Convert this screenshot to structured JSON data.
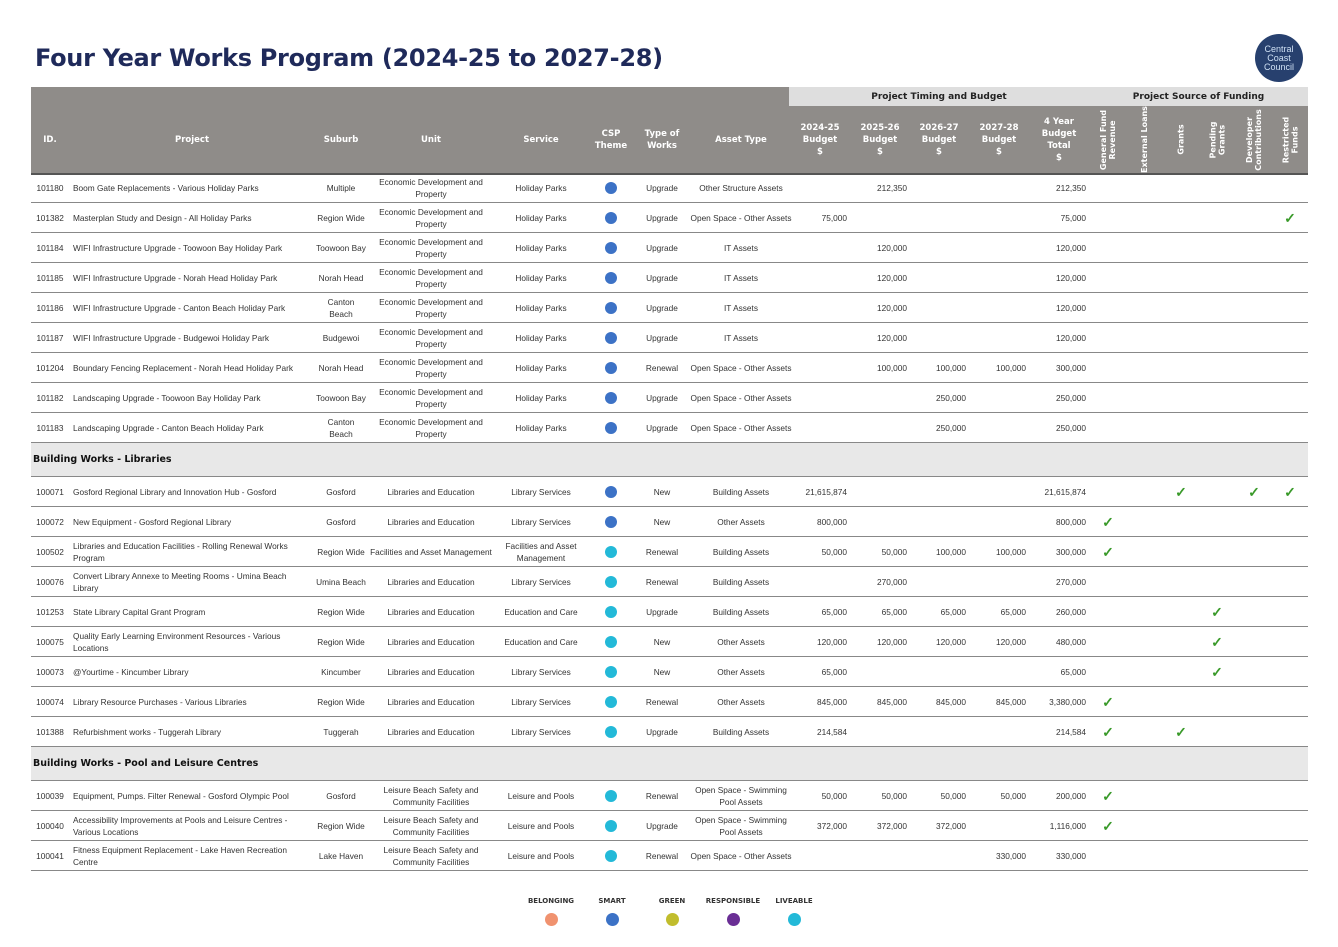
{
  "page": {
    "title": "Four Year Works Program (2024-25 to 2027-28)",
    "logo_lines": [
      "Central",
      "Coast",
      "Council"
    ]
  },
  "bands": {
    "timing": "Project Timing and Budget",
    "funding": "Project Source of Funding"
  },
  "columns": {
    "id": "ID.",
    "project": "Project",
    "suburb": "Suburb",
    "unit": "Unit",
    "service": "Service",
    "csp_theme": "CSP\nTheme",
    "type_of_works": "Type of\nWorks",
    "asset_type": "Asset Type",
    "y2024": "2024-25\nBudget\n$",
    "y2025": "2025-26\nBudget\n$",
    "y2026": "2026-27\nBudget\n$",
    "y2027": "2027-28\nBudget\n$",
    "total": "4 Year\nBudget\nTotal\n$",
    "funding": [
      "General Fund\nRevenue",
      "External Loans",
      "Grants",
      "Pending\nGrants",
      "Developer\nContributions",
      "Restricted\nFunds"
    ]
  },
  "theme_colors": {
    "belonging": "#f0926f",
    "smart": "#3c72c6",
    "green": "#c1bd2d",
    "responsible": "#6a2e95",
    "liveable": "#23b9d8"
  },
  "sections": [
    {
      "heading": "",
      "rows": [
        {
          "id": "101180",
          "project": "Boom Gate Replacements - Various Holiday Parks",
          "suburb": "Multiple",
          "unit": "Economic Development and Property",
          "service": "Holiday Parks",
          "theme": "smart",
          "works": "Upgrade",
          "asset": "Other Structure Assets",
          "b1": "",
          "b2": "212,350",
          "b3": "",
          "b4": "",
          "total": "212,350",
          "f": [
            false,
            false,
            false,
            false,
            false,
            false
          ]
        },
        {
          "id": "101382",
          "project": "Masterplan Study and Design - All Holiday Parks",
          "suburb": "Region Wide",
          "unit": "Economic Development and Property",
          "service": "Holiday Parks",
          "theme": "smart",
          "works": "Upgrade",
          "asset": "Open Space - Other Assets",
          "b1": "75,000",
          "b2": "",
          "b3": "",
          "b4": "",
          "total": "75,000",
          "f": [
            false,
            false,
            false,
            false,
            false,
            true
          ]
        },
        {
          "id": "101184",
          "project": "WIFI Infrastructure Upgrade - Toowoon Bay Holiday Park",
          "suburb": "Toowoon Bay",
          "unit": "Economic Development and Property",
          "service": "Holiday Parks",
          "theme": "smart",
          "works": "Upgrade",
          "asset": "IT Assets",
          "b1": "",
          "b2": "120,000",
          "b3": "",
          "b4": "",
          "total": "120,000",
          "f": [
            false,
            false,
            false,
            false,
            false,
            false
          ]
        },
        {
          "id": "101185",
          "project": "WIFI Infrastructure Upgrade - Norah Head Holiday Park",
          "suburb": "Norah Head",
          "unit": "Economic Development and Property",
          "service": "Holiday Parks",
          "theme": "smart",
          "works": "Upgrade",
          "asset": "IT Assets",
          "b1": "",
          "b2": "120,000",
          "b3": "",
          "b4": "",
          "total": "120,000",
          "f": [
            false,
            false,
            false,
            false,
            false,
            false
          ]
        },
        {
          "id": "101186",
          "project": "WIFI Infrastructure Upgrade - Canton Beach Holiday Park",
          "suburb": "Canton Beach",
          "unit": "Economic Development and Property",
          "service": "Holiday Parks",
          "theme": "smart",
          "works": "Upgrade",
          "asset": "IT Assets",
          "b1": "",
          "b2": "120,000",
          "b3": "",
          "b4": "",
          "total": "120,000",
          "f": [
            false,
            false,
            false,
            false,
            false,
            false
          ]
        },
        {
          "id": "101187",
          "project": "WIFI Infrastructure Upgrade - Budgewoi Holiday Park",
          "suburb": "Budgewoi",
          "unit": "Economic Development and Property",
          "service": "Holiday Parks",
          "theme": "smart",
          "works": "Upgrade",
          "asset": "IT Assets",
          "b1": "",
          "b2": "120,000",
          "b3": "",
          "b4": "",
          "total": "120,000",
          "f": [
            false,
            false,
            false,
            false,
            false,
            false
          ]
        },
        {
          "id": "101204",
          "project": "Boundary Fencing Replacement - Norah Head Holiday Park",
          "suburb": "Norah Head",
          "unit": "Economic Development and Property",
          "service": "Holiday Parks",
          "theme": "smart",
          "works": "Renewal",
          "asset": "Open Space - Other Assets",
          "b1": "",
          "b2": "100,000",
          "b3": "100,000",
          "b4": "100,000",
          "total": "300,000",
          "f": [
            false,
            false,
            false,
            false,
            false,
            false
          ]
        },
        {
          "id": "101182",
          "project": "Landscaping Upgrade - Toowoon Bay Holiday Park",
          "suburb": "Toowoon Bay",
          "unit": "Economic Development and Property",
          "service": "Holiday Parks",
          "theme": "smart",
          "works": "Upgrade",
          "asset": "Open Space - Other Assets",
          "b1": "",
          "b2": "",
          "b3": "250,000",
          "b4": "",
          "total": "250,000",
          "f": [
            false,
            false,
            false,
            false,
            false,
            false
          ]
        },
        {
          "id": "101183",
          "project": "Landscaping Upgrade - Canton Beach Holiday Park",
          "suburb": "Canton Beach",
          "unit": "Economic Development and Property",
          "service": "Holiday Parks",
          "theme": "smart",
          "works": "Upgrade",
          "asset": "Open Space - Other Assets",
          "b1": "",
          "b2": "",
          "b3": "250,000",
          "b4": "",
          "total": "250,000",
          "f": [
            false,
            false,
            false,
            false,
            false,
            false
          ]
        }
      ]
    },
    {
      "heading": "Building Works - Libraries",
      "rows": [
        {
          "id": "100071",
          "project": "Gosford Regional Library and Innovation Hub - Gosford",
          "suburb": "Gosford",
          "unit": "Libraries and Education",
          "service": "Library Services",
          "theme": "smart",
          "works": "New",
          "asset": "Building Assets",
          "b1": "21,615,874",
          "b2": "",
          "b3": "",
          "b4": "",
          "total": "21,615,874",
          "f": [
            false,
            false,
            true,
            false,
            true,
            true
          ]
        },
        {
          "id": "100072",
          "project": "New Equipment - Gosford Regional Library",
          "suburb": "Gosford",
          "unit": "Libraries and Education",
          "service": "Library Services",
          "theme": "smart",
          "works": "New",
          "asset": "Other Assets",
          "b1": "800,000",
          "b2": "",
          "b3": "",
          "b4": "",
          "total": "800,000",
          "f": [
            true,
            false,
            false,
            false,
            false,
            false
          ]
        },
        {
          "id": "100502",
          "project": "Libraries and Education Facilities - Rolling Renewal Works Program",
          "suburb": "Region Wide",
          "unit": "Facilities and Asset Management",
          "service": "Facilities and Asset Management",
          "theme": "liveable",
          "works": "Renewal",
          "asset": "Building Assets",
          "b1": "50,000",
          "b2": "50,000",
          "b3": "100,000",
          "b4": "100,000",
          "total": "300,000",
          "f": [
            true,
            false,
            false,
            false,
            false,
            false
          ]
        },
        {
          "id": "100076",
          "project": "Convert Library Annexe to Meeting Rooms - Umina Beach Library",
          "suburb": "Umina Beach",
          "unit": "Libraries and Education",
          "service": "Library Services",
          "theme": "liveable",
          "works": "Renewal",
          "asset": "Building Assets",
          "b1": "",
          "b2": "270,000",
          "b3": "",
          "b4": "",
          "total": "270,000",
          "f": [
            false,
            false,
            false,
            false,
            false,
            false
          ]
        },
        {
          "id": "101253",
          "project": "State Library Capital Grant Program",
          "suburb": "Region Wide",
          "unit": "Libraries and Education",
          "service": "Education and Care",
          "theme": "liveable",
          "works": "Upgrade",
          "asset": "Building Assets",
          "b1": "65,000",
          "b2": "65,000",
          "b3": "65,000",
          "b4": "65,000",
          "total": "260,000",
          "f": [
            false,
            false,
            false,
            true,
            false,
            false
          ]
        },
        {
          "id": "100075",
          "project": "Quality Early Learning Environment Resources - Various Locations",
          "suburb": "Region Wide",
          "unit": "Libraries and Education",
          "service": "Education and Care",
          "theme": "liveable",
          "works": "New",
          "asset": "Other Assets",
          "b1": "120,000",
          "b2": "120,000",
          "b3": "120,000",
          "b4": "120,000",
          "total": "480,000",
          "f": [
            false,
            false,
            false,
            true,
            false,
            false
          ]
        },
        {
          "id": "100073",
          "project": " @Yourtime - Kincumber Library",
          "suburb": "Kincumber",
          "unit": "Libraries and Education",
          "service": "Library Services",
          "theme": "liveable",
          "works": "New",
          "asset": "Other Assets",
          "b1": "65,000",
          "b2": "",
          "b3": "",
          "b4": "",
          "total": "65,000",
          "f": [
            false,
            false,
            false,
            true,
            false,
            false
          ]
        },
        {
          "id": "100074",
          "project": "Library Resource Purchases - Various Libraries",
          "suburb": "Region Wide",
          "unit": "Libraries and Education",
          "service": "Library Services",
          "theme": "liveable",
          "works": "Renewal",
          "asset": "Other Assets",
          "b1": "845,000",
          "b2": "845,000",
          "b3": "845,000",
          "b4": "845,000",
          "total": "3,380,000",
          "f": [
            true,
            false,
            false,
            false,
            false,
            false
          ]
        },
        {
          "id": "101388",
          "project": "Refurbishment works - Tuggerah Library",
          "suburb": "Tuggerah",
          "unit": "Libraries and Education",
          "service": "Library Services",
          "theme": "liveable",
          "works": "Upgrade",
          "asset": "Building Assets",
          "b1": "214,584",
          "b2": "",
          "b3": "",
          "b4": "",
          "total": "214,584",
          "f": [
            true,
            false,
            true,
            false,
            false,
            false
          ]
        }
      ]
    },
    {
      "heading": "Building Works - Pool and Leisure Centres",
      "rows": [
        {
          "id": "100039",
          "project": "Equipment, Pumps. Filter Renewal - Gosford Olympic Pool",
          "suburb": "Gosford",
          "unit": "Leisure Beach Safety and Community Facilities",
          "service": "Leisure and Pools",
          "theme": "liveable",
          "works": "Renewal",
          "asset": "Open Space - Swimming Pool Assets",
          "b1": "50,000",
          "b2": "50,000",
          "b3": "50,000",
          "b4": "50,000",
          "total": "200,000",
          "f": [
            true,
            false,
            false,
            false,
            false,
            false
          ]
        },
        {
          "id": "100040",
          "project": "Accessibility Improvements at Pools and Leisure Centres - Various Locations",
          "suburb": "Region Wide",
          "unit": "Leisure Beach Safety and Community Facilities",
          "service": "Leisure and Pools",
          "theme": "liveable",
          "works": "Upgrade",
          "asset": "Open Space - Swimming Pool Assets",
          "b1": "372,000",
          "b2": "372,000",
          "b3": "372,000",
          "b4": "",
          "total": "1,116,000",
          "f": [
            true,
            false,
            false,
            false,
            false,
            false
          ]
        },
        {
          "id": "100041",
          "project": "Fitness Equipment Replacement - Lake Haven Recreation Centre",
          "suburb": "Lake Haven",
          "unit": "Leisure Beach Safety and Community Facilities",
          "service": "Leisure and Pools",
          "theme": "liveable",
          "works": "Renewal",
          "asset": "Open Space - Other Assets",
          "b1": "",
          "b2": "",
          "b3": "",
          "b4": "330,000",
          "total": "330,000",
          "f": [
            false,
            false,
            false,
            false,
            false,
            false
          ]
        }
      ]
    }
  ],
  "tick_glyph": "✓",
  "legend": [
    {
      "label": "BELONGING",
      "theme": "belonging"
    },
    {
      "label": "SMART",
      "theme": "smart"
    },
    {
      "label": "GREEN",
      "theme": "green"
    },
    {
      "label": "RESPONSIBLE",
      "theme": "responsible"
    },
    {
      "label": "LIVEABLE",
      "theme": "liveable"
    }
  ]
}
